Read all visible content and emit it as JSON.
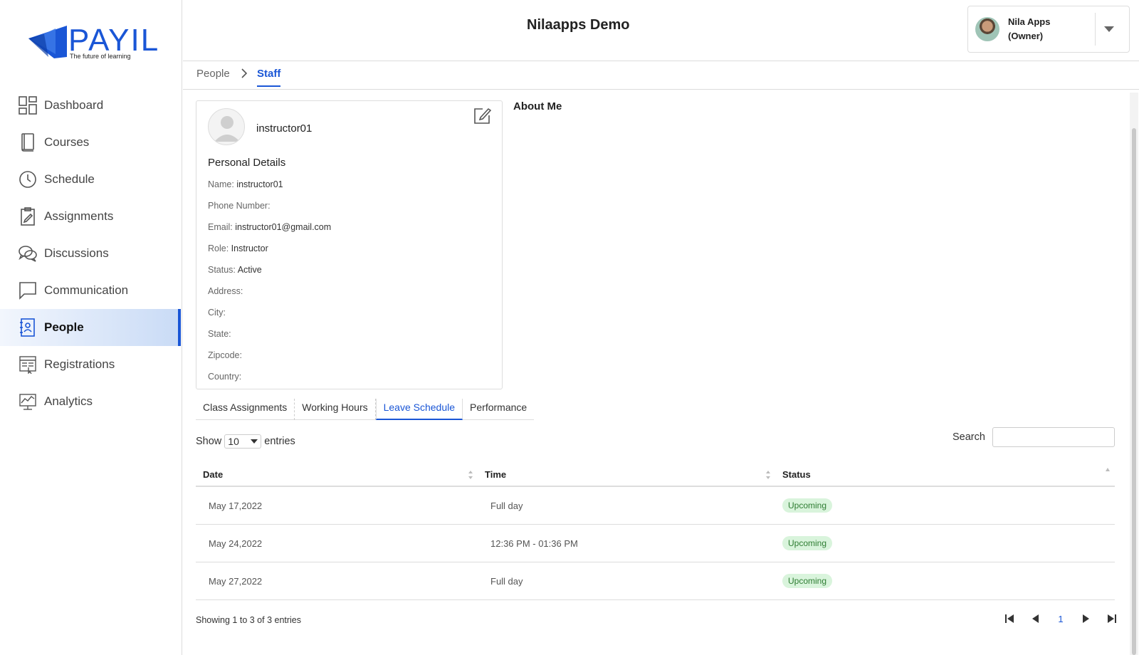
{
  "app": {
    "title": "Nilaapps Demo"
  },
  "logo": {
    "name": "PAYIL",
    "tagline": "The future of learning"
  },
  "user": {
    "name": "Nila Apps",
    "role": "(Owner)"
  },
  "sidebar": {
    "items": [
      {
        "label": "Dashboard",
        "icon": "dashboard-icon"
      },
      {
        "label": "Courses",
        "icon": "book-icon"
      },
      {
        "label": "Schedule",
        "icon": "clock-icon"
      },
      {
        "label": "Assignments",
        "icon": "clipboard-icon"
      },
      {
        "label": "Discussions",
        "icon": "chat-bubbles-icon"
      },
      {
        "label": "Communication",
        "icon": "message-icon"
      },
      {
        "label": "People",
        "icon": "contact-book-icon",
        "active": true
      },
      {
        "label": "Registrations",
        "icon": "registration-form-icon"
      },
      {
        "label": "Analytics",
        "icon": "analytics-icon"
      }
    ]
  },
  "breadcrumb": {
    "parent": "People",
    "current": "Staff"
  },
  "profile": {
    "username": "instructor01",
    "section_title": "Personal Details",
    "details": [
      {
        "label": "Name:",
        "value": "instructor01"
      },
      {
        "label": "Phone Number:",
        "value": ""
      },
      {
        "label": "Email:",
        "value": "instructor01@gmail.com"
      },
      {
        "label": "Role:",
        "value": "Instructor"
      },
      {
        "label": "Status:",
        "value": "Active"
      },
      {
        "label": "Address:",
        "value": ""
      },
      {
        "label": "City:",
        "value": ""
      },
      {
        "label": "State:",
        "value": ""
      },
      {
        "label": "Zipcode:",
        "value": ""
      },
      {
        "label": "Country:",
        "value": ""
      }
    ]
  },
  "about": {
    "title": "About Me"
  },
  "tabs": [
    {
      "label": "Class Assignments"
    },
    {
      "label": "Working Hours"
    },
    {
      "label": "Leave Schedule",
      "active": true
    },
    {
      "label": "Performance"
    }
  ],
  "table_controls": {
    "show_label": "Show",
    "page_size": "10",
    "entries_label": "entries",
    "search_label": "Search",
    "search_value": ""
  },
  "table": {
    "columns": [
      "Date",
      "Time",
      "Status"
    ],
    "rows": [
      {
        "date": "May 17,2022",
        "time": "Full day",
        "status": "Upcoming"
      },
      {
        "date": "May 24,2022",
        "time": "12:36 PM - 01:36 PM",
        "status": "Upcoming"
      },
      {
        "date": "May 27,2022",
        "time": "Full day",
        "status": "Upcoming"
      }
    ]
  },
  "footer": {
    "showing": "Showing 1 to 3 of 3 entries",
    "current_page": "1"
  },
  "colors": {
    "accent": "#1a56d6",
    "badge_bg": "#d9f4dc",
    "badge_text": "#2e7d32"
  }
}
